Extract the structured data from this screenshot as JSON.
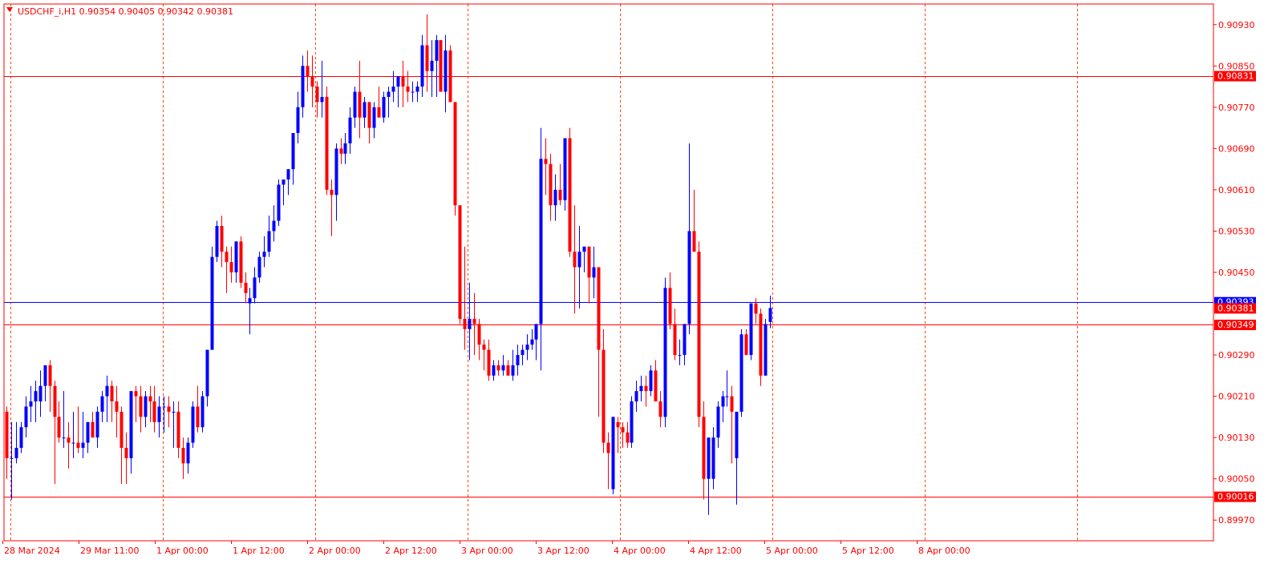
{
  "header": {
    "arrow_icon": "triangle-down-icon",
    "text": "USDCHF_i,H1  0.90354 0.90405 0.90342 0.90381"
  },
  "colors": {
    "frame": "#ff0000",
    "grid": "#ff4500",
    "bull": "#0000ff",
    "bear": "#ff0000",
    "hline_red": "#ff0000",
    "hline_blue": "#0000ff",
    "label_text": "#ffffff"
  },
  "chart_data": {
    "type": "candlestick",
    "symbol": "USDCHF_i",
    "timeframe": "H1",
    "ohlc_last": {
      "open": 0.90354,
      "high": 0.90405,
      "low": 0.90342,
      "close": 0.90381
    },
    "ylim": [
      0.8993,
      0.9097
    ],
    "y_ticks": [
      "0.90930",
      "0.90850",
      "0.90770",
      "0.90690",
      "0.90610",
      "0.90530",
      "0.90450",
      "0.90290",
      "0.90210",
      "0.90130",
      "0.90050",
      "0.89970"
    ],
    "x_ticks": [
      "28 Mar 2024",
      "29 Mar 11:00",
      "1 Apr 00:00",
      "1 Apr 12:00",
      "2 Apr 00:00",
      "2 Apr 12:00",
      "3 Apr 00:00",
      "3 Apr 12:00",
      "4 Apr 00:00",
      "4 Apr 12:00",
      "5 Apr 00:00",
      "5 Apr 12:00",
      "8 Apr 00:00"
    ],
    "grid": "vertical dashed at each x tick",
    "horizontal_lines": [
      {
        "value": 0.90831,
        "label": "0.90831",
        "color": "#ff0000"
      },
      {
        "value": 0.90393,
        "label": "0.90393",
        "color": "#0000ff"
      },
      {
        "value": 0.90349,
        "label": "0.90349",
        "color": "#ff0000"
      },
      {
        "value": 0.90016,
        "label": "0.90016",
        "color": "#ff0000"
      }
    ],
    "price_label": {
      "value": 0.90381,
      "label": "0.90381",
      "color": "#ff0000"
    },
    "candles": [
      [
        0.9018,
        0.9019,
        0.9005,
        0.9009
      ],
      [
        0.9009,
        0.9016,
        0.9001,
        0.9009
      ],
      [
        0.9009,
        0.9016,
        0.9008,
        0.9011
      ],
      [
        0.9011,
        0.9016,
        0.901,
        0.9015
      ],
      [
        0.9015,
        0.9021,
        0.9013,
        0.9019
      ],
      [
        0.9019,
        0.9023,
        0.9016,
        0.902
      ],
      [
        0.902,
        0.9024,
        0.9016,
        0.9022
      ],
      [
        0.902,
        0.9026,
        0.9017,
        0.9023
      ],
      [
        0.9023,
        0.9027,
        0.902,
        0.9027
      ],
      [
        0.9027,
        0.9028,
        0.9018,
        0.9023
      ],
      [
        0.9023,
        0.9024,
        0.9004,
        0.9017
      ],
      [
        0.9017,
        0.902,
        0.9012,
        0.9013
      ],
      [
        0.9013,
        0.9022,
        0.9011,
        0.9013
      ],
      [
        0.9013,
        0.9016,
        0.9007,
        0.9012
      ],
      [
        0.9012,
        0.9018,
        0.9009,
        0.9012
      ],
      [
        0.9012,
        0.9019,
        0.901,
        0.9011
      ],
      [
        0.9011,
        0.9018,
        0.9009,
        0.9012
      ],
      [
        0.9012,
        0.9016,
        0.901,
        0.9016
      ],
      [
        0.9016,
        0.9018,
        0.9013,
        0.9013
      ],
      [
        0.9013,
        0.9019,
        0.9011,
        0.9018
      ],
      [
        0.9018,
        0.9022,
        0.9016,
        0.9021
      ],
      [
        0.9021,
        0.9025,
        0.9016,
        0.9023
      ],
      [
        0.9023,
        0.9024,
        0.9016,
        0.902
      ],
      [
        0.902,
        0.9023,
        0.9013,
        0.9018
      ],
      [
        0.9018,
        0.9019,
        0.9004,
        0.9011
      ],
      [
        0.9011,
        0.9014,
        0.9004,
        0.9009
      ],
      [
        0.9009,
        0.9022,
        0.9006,
        0.9022
      ],
      [
        0.9022,
        0.9023,
        0.9016,
        0.9021
      ],
      [
        0.9021,
        0.9023,
        0.9014,
        0.9017
      ],
      [
        0.9017,
        0.9022,
        0.9015,
        0.9021
      ],
      [
        0.9021,
        0.9023,
        0.9016,
        0.902
      ],
      [
        0.902,
        0.9023,
        0.9014,
        0.9016
      ],
      [
        0.9016,
        0.9021,
        0.9013,
        0.9019
      ],
      [
        0.9019,
        0.9021,
        0.9014,
        0.9019
      ],
      [
        0.9019,
        0.9021,
        0.9015,
        0.9018
      ],
      [
        0.9018,
        0.902,
        0.9011,
        0.9018
      ],
      [
        0.9018,
        0.902,
        0.9009,
        0.9011
      ],
      [
        0.9011,
        0.9013,
        0.9005,
        0.9008
      ],
      [
        0.9008,
        0.9013,
        0.9006,
        0.9012
      ],
      [
        0.9012,
        0.902,
        0.9011,
        0.9019
      ],
      [
        0.9019,
        0.9023,
        0.9014,
        0.9015
      ],
      [
        0.9015,
        0.9022,
        0.9014,
        0.9021
      ],
      [
        0.9021,
        0.903,
        0.9019,
        0.903
      ],
      [
        0.903,
        0.905,
        0.903,
        0.9048
      ],
      [
        0.9048,
        0.9055,
        0.9047,
        0.9054
      ],
      [
        0.9054,
        0.9056,
        0.9046,
        0.9049
      ],
      [
        0.9049,
        0.905,
        0.9041,
        0.9047
      ],
      [
        0.9047,
        0.905,
        0.9043,
        0.9045
      ],
      [
        0.9045,
        0.9051,
        0.9043,
        0.9051
      ],
      [
        0.9051,
        0.9052,
        0.9042,
        0.9043
      ],
      [
        0.9043,
        0.9045,
        0.9039,
        0.9041
      ],
      [
        0.9039,
        0.9042,
        0.9033,
        0.904
      ],
      [
        0.904,
        0.9046,
        0.9039,
        0.9044
      ],
      [
        0.9044,
        0.9049,
        0.9043,
        0.9048
      ],
      [
        0.9048,
        0.9052,
        0.9046,
        0.9049
      ],
      [
        0.9049,
        0.9056,
        0.9048,
        0.9053
      ],
      [
        0.9053,
        0.9058,
        0.9051,
        0.9055
      ],
      [
        0.9055,
        0.9063,
        0.9054,
        0.9062
      ],
      [
        0.9062,
        0.9063,
        0.9058,
        0.9063
      ],
      [
        0.9063,
        0.9065,
        0.906,
        0.9065
      ],
      [
        0.9065,
        0.907,
        0.9062,
        0.9072
      ],
      [
        0.9072,
        0.908,
        0.907,
        0.9077
      ],
      [
        0.9077,
        0.9087,
        0.9075,
        0.9085
      ],
      [
        0.9085,
        0.9088,
        0.908,
        0.9083
      ],
      [
        0.9083,
        0.9087,
        0.9077,
        0.9081
      ],
      [
        0.9081,
        0.9082,
        0.9075,
        0.9078
      ],
      [
        0.9078,
        0.9086,
        0.9075,
        0.9079
      ],
      [
        0.9079,
        0.9081,
        0.906,
        0.9061
      ],
      [
        0.9061,
        0.9063,
        0.9052,
        0.906
      ],
      [
        0.906,
        0.907,
        0.9055,
        0.9069
      ],
      [
        0.9069,
        0.9071,
        0.9066,
        0.9068
      ],
      [
        0.9068,
        0.9072,
        0.9066,
        0.907
      ],
      [
        0.907,
        0.9077,
        0.9068,
        0.9075
      ],
      [
        0.9075,
        0.9081,
        0.9073,
        0.908
      ],
      [
        0.908,
        0.9086,
        0.9071,
        0.9075
      ],
      [
        0.9075,
        0.9079,
        0.9073,
        0.9078
      ],
      [
        0.9078,
        0.9078,
        0.907,
        0.9073
      ],
      [
        0.9073,
        0.9078,
        0.9071,
        0.9077
      ],
      [
        0.9077,
        0.9081,
        0.9075,
        0.9075
      ],
      [
        0.9075,
        0.908,
        0.9074,
        0.9079
      ],
      [
        0.9079,
        0.9081,
        0.9075,
        0.908
      ],
      [
        0.908,
        0.9084,
        0.9078,
        0.9081
      ],
      [
        0.9081,
        0.9083,
        0.9077,
        0.9083
      ],
      [
        0.9083,
        0.9086,
        0.9077,
        0.9081
      ],
      [
        0.9081,
        0.9084,
        0.9078,
        0.908
      ],
      [
        0.908,
        0.9082,
        0.9078,
        0.908
      ],
      [
        0.908,
        0.9082,
        0.9078,
        0.9081
      ],
      [
        0.9081,
        0.9091,
        0.9079,
        0.9089
      ],
      [
        0.9089,
        0.9095,
        0.908,
        0.9084
      ],
      [
        0.9084,
        0.909,
        0.9079,
        0.9086
      ],
      [
        0.9086,
        0.9091,
        0.9079,
        0.909
      ],
      [
        0.909,
        0.909,
        0.908,
        0.908
      ],
      [
        0.908,
        0.9091,
        0.9076,
        0.9088
      ],
      [
        0.9088,
        0.9089,
        0.9078,
        0.9078
      ],
      [
        0.9078,
        0.9078,
        0.9056,
        0.9058
      ],
      [
        0.9058,
        0.9058,
        0.9035,
        0.9036
      ],
      [
        0.9036,
        0.905,
        0.903,
        0.9034
      ],
      [
        0.9034,
        0.9043,
        0.9028,
        0.9036
      ],
      [
        0.9036,
        0.9041,
        0.9029,
        0.9035
      ],
      [
        0.9035,
        0.9036,
        0.9028,
        0.9031
      ],
      [
        0.9031,
        0.9032,
        0.9026,
        0.903
      ],
      [
        0.903,
        0.9032,
        0.9024,
        0.9025
      ],
      [
        0.9025,
        0.9028,
        0.9024,
        0.9027
      ],
      [
        0.9027,
        0.9028,
        0.9025,
        0.9026
      ],
      [
        0.9026,
        0.9029,
        0.9025,
        0.9027
      ],
      [
        0.9027,
        0.9028,
        0.9025,
        0.9025
      ],
      [
        0.9025,
        0.903,
        0.9024,
        0.9027
      ],
      [
        0.9027,
        0.9031,
        0.9025,
        0.9029
      ],
      [
        0.9029,
        0.9031,
        0.9027,
        0.903
      ],
      [
        0.903,
        0.9033,
        0.9028,
        0.9031
      ],
      [
        0.9031,
        0.9034,
        0.903,
        0.9032
      ],
      [
        0.9032,
        0.9035,
        0.9028,
        0.9035
      ],
      [
        0.9035,
        0.9073,
        0.9026,
        0.9067
      ],
      [
        0.9067,
        0.9071,
        0.906,
        0.9066
      ],
      [
        0.9066,
        0.9068,
        0.9055,
        0.9058
      ],
      [
        0.9058,
        0.9064,
        0.9055,
        0.9061
      ],
      [
        0.9061,
        0.9066,
        0.9058,
        0.9059
      ],
      [
        0.9059,
        0.9069,
        0.9057,
        0.9071
      ],
      [
        0.9071,
        0.9073,
        0.9048,
        0.9049
      ],
      [
        0.9049,
        0.9058,
        0.9037,
        0.9046
      ],
      [
        0.9046,
        0.9054,
        0.9038,
        0.9049
      ],
      [
        0.9049,
        0.905,
        0.9045,
        0.905
      ],
      [
        0.905,
        0.905,
        0.9039,
        0.9044
      ],
      [
        0.9044,
        0.905,
        0.904,
        0.9046
      ],
      [
        0.9046,
        0.9046,
        0.9017,
        0.903
      ],
      [
        0.903,
        0.9034,
        0.901,
        0.9012
      ],
      [
        0.9012,
        0.9014,
        0.9003,
        0.901
      ],
      [
        0.9003,
        0.9017,
        0.9002,
        0.9017
      ],
      [
        0.9016,
        0.9017,
        0.901,
        0.9015
      ],
      [
        0.9015,
        0.9016,
        0.9011,
        0.9014
      ],
      [
        0.9014,
        0.9016,
        0.9011,
        0.9012
      ],
      [
        0.9012,
        0.9021,
        0.9011,
        0.902
      ],
      [
        0.902,
        0.9024,
        0.9018,
        0.9022
      ],
      [
        0.9022,
        0.9025,
        0.902,
        0.9023
      ],
      [
        0.9023,
        0.9025,
        0.9019,
        0.9022
      ],
      [
        0.9022,
        0.9027,
        0.9021,
        0.9026
      ],
      [
        0.9026,
        0.9028,
        0.9021,
        0.902
      ],
      [
        0.902,
        0.9022,
        0.9015,
        0.9017
      ],
      [
        0.9017,
        0.9044,
        0.9015,
        0.9042
      ],
      [
        0.9042,
        0.9045,
        0.9034,
        0.9035
      ],
      [
        0.9035,
        0.9038,
        0.9028,
        0.9029
      ],
      [
        0.9029,
        0.9032,
        0.9027,
        0.9029
      ],
      [
        0.9029,
        0.9035,
        0.9027,
        0.9035
      ],
      [
        0.9035,
        0.907,
        0.9033,
        0.9053
      ],
      [
        0.9053,
        0.9061,
        0.905,
        0.9049
      ],
      [
        0.9049,
        0.9051,
        0.9015,
        0.9017
      ],
      [
        0.9017,
        0.902,
        0.9001,
        0.9005
      ],
      [
        0.9005,
        0.901,
        0.8998,
        0.9013
      ],
      [
        0.9005,
        0.9015,
        0.9003,
        0.9013
      ],
      [
        0.9013,
        0.902,
        0.9011,
        0.9019
      ],
      [
        0.9019,
        0.9022,
        0.9016,
        0.9021
      ],
      [
        0.9021,
        0.9026,
        0.9019,
        0.9021
      ],
      [
        0.9021,
        0.9023,
        0.9008,
        0.9018
      ],
      [
        0.9009,
        0.9018,
        0.9,
        0.9018
      ],
      [
        0.9018,
        0.9034,
        0.9017,
        0.9033
      ],
      [
        0.9033,
        0.9034,
        0.9029,
        0.9029
      ],
      [
        0.9029,
        0.9039,
        0.9028,
        0.9039
      ],
      [
        0.9039,
        0.904,
        0.9035,
        0.9037
      ],
      [
        0.9037,
        0.9038,
        0.9023,
        0.9025
      ],
      [
        0.9025,
        0.9036,
        0.9025,
        0.9035
      ],
      [
        0.90354,
        0.90405,
        0.90342,
        0.90381
      ]
    ]
  }
}
